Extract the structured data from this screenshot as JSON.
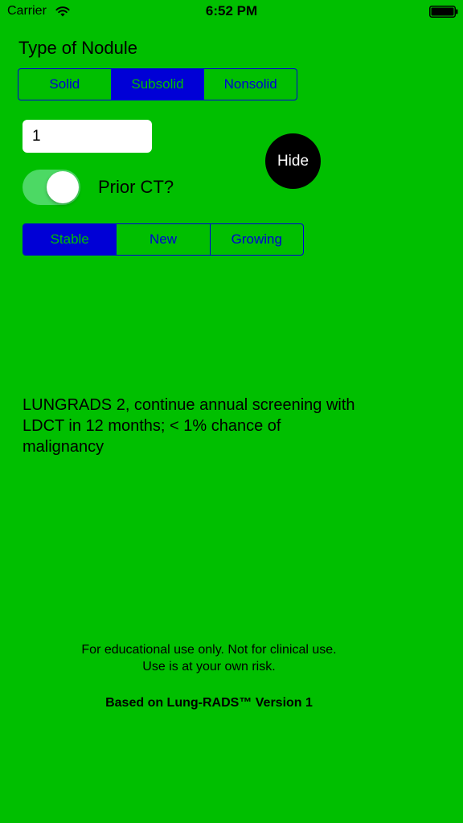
{
  "status_bar": {
    "carrier": "Carrier",
    "time": "6:52 PM",
    "wifi_icon": "wifi-icon",
    "battery_icon": "battery-icon"
  },
  "nodule_type": {
    "title": "Type of Nodule",
    "options": [
      "Solid",
      "Subsolid",
      "Nonsolid"
    ],
    "selected": "Subsolid"
  },
  "size_field": {
    "value": "1"
  },
  "hide_button": {
    "label": "Hide"
  },
  "prior_ct": {
    "label": "Prior CT?",
    "on": true
  },
  "change": {
    "options": [
      "Stable",
      "New",
      "Growing"
    ],
    "selected": "Stable"
  },
  "result": {
    "text": "LUNGRADS 2, continue annual screening with LDCT in 12 months; < 1% chance of malignancy"
  },
  "footer": {
    "disclaimer_line1": "For educational use only. Not for clinical use.",
    "disclaimer_line2": "Use is at your own risk.",
    "version_note": "Based on Lung-RADS™ Version 1"
  },
  "colors": {
    "background": "#00bf00",
    "segment_blue": "#0000d6",
    "toggle_on": "#4cd964"
  }
}
